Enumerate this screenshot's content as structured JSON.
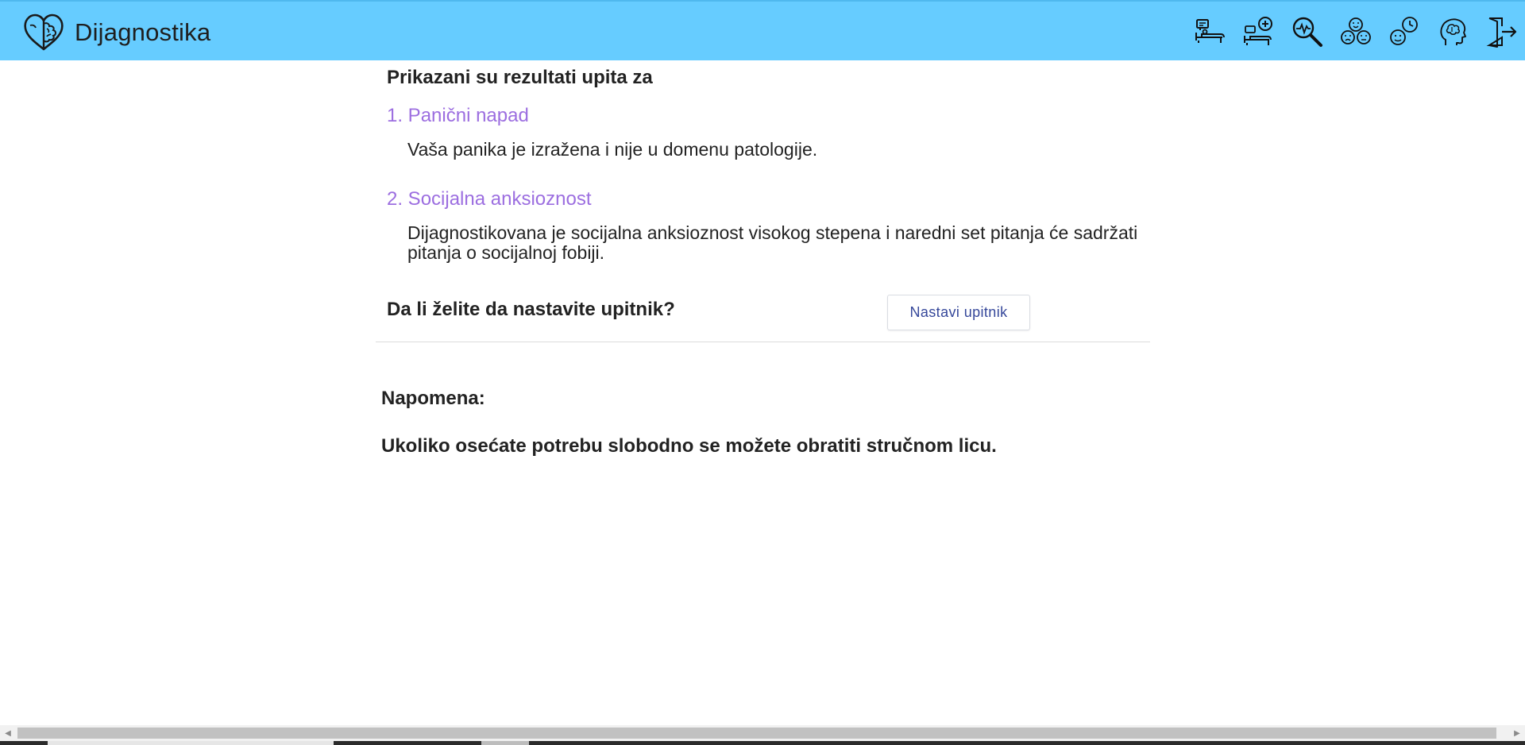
{
  "header": {
    "title": "Dijagnostika",
    "icons": [
      "patient-couch-icon",
      "add-patient-icon",
      "search-diagnosis-icon",
      "emotions-icon",
      "mood-history-icon",
      "mind-brain-icon",
      "logout-icon"
    ]
  },
  "results": {
    "heading": "Prikazani su rezultati upita za",
    "items": [
      {
        "title": "1. Panični napad",
        "description": "Vaša panika je izražena i nije u domenu patologije."
      },
      {
        "title": "2. Socijalna anksioznost",
        "description": "Dijagnostikovana je socijalna anksioznost visokog stepena i naredni set pitanja će sadržati pitanja o socijalnoj fobiji."
      }
    ]
  },
  "continue": {
    "question": "Da li želite da nastavite upitnik?",
    "button_label": "Nastavi upitnik"
  },
  "note": {
    "label": "Napomena:",
    "text": "Ukoliko osećate potrebu slobodno se možete obratiti stručnom licu."
  },
  "colors": {
    "header_bg": "#66ccff",
    "result_title": "#9c6ee0",
    "button_text": "#35479a"
  }
}
